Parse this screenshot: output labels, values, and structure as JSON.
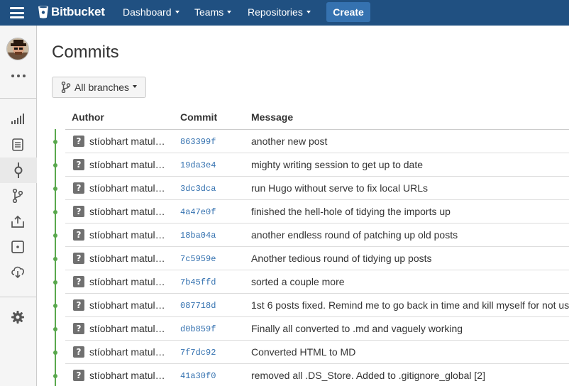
{
  "app": {
    "brand": "Bitbucket",
    "nav": [
      {
        "label": "Dashboard"
      },
      {
        "label": "Teams"
      },
      {
        "label": "Repositories"
      }
    ],
    "create_label": "Create"
  },
  "colors": {
    "header_bg": "#205081",
    "create_bg": "#3572b0",
    "link": "#3572b0",
    "graph": "#59a84d"
  },
  "sidebar": {
    "more_icon": "ellipsis-icon",
    "items": [
      {
        "icon": "overview-icon"
      },
      {
        "icon": "source-icon"
      },
      {
        "icon": "commits-icon",
        "active": true
      },
      {
        "icon": "branches-icon"
      },
      {
        "icon": "pull-requests-icon"
      },
      {
        "icon": "pipelines-icon"
      },
      {
        "icon": "downloads-icon"
      },
      {
        "icon": "settings-icon"
      }
    ]
  },
  "page": {
    "title": "Commits",
    "branch_filter": "All branches"
  },
  "table": {
    "headers": {
      "author": "Author",
      "commit": "Commit",
      "message": "Message"
    },
    "rows": [
      {
        "author": "stíobhart matulevicz",
        "hash": "863399f",
        "message": "another new post"
      },
      {
        "author": "stíobhart matulevicz",
        "hash": "19da3e4",
        "message": "mighty writing session to get up to date"
      },
      {
        "author": "stíobhart matulevicz",
        "hash": "3dc3dca",
        "message": "run Hugo without serve to fix local URLs"
      },
      {
        "author": "stíobhart matulevicz",
        "hash": "4a47e0f",
        "message": "finished the hell-hole of tidying the imports up"
      },
      {
        "author": "stíobhart matulevicz",
        "hash": "18ba04a",
        "message": "another endless round of patching up old posts"
      },
      {
        "author": "stíobhart matulevicz",
        "hash": "7c5959e",
        "message": "Another tedious round of tidying up posts"
      },
      {
        "author": "stíobhart matulevicz",
        "hash": "7b45ffd",
        "message": "sorted a couple more"
      },
      {
        "author": "stíobhart matulevicz",
        "hash": "087718d",
        "message": "1st 6 posts fixed. Remind me to go back in time and kill myself for not us"
      },
      {
        "author": "stíobhart matulevicz",
        "hash": "d0b859f",
        "message": "Finally all converted to .md and vaguely working"
      },
      {
        "author": "stíobhart matulevicz",
        "hash": "7f7dc92",
        "message": "Converted HTML to MD"
      },
      {
        "author": "stíobhart matulevicz",
        "hash": "41a30f0",
        "message": "removed all .DS_Store. Added to .gitignore_global [2]"
      }
    ]
  }
}
